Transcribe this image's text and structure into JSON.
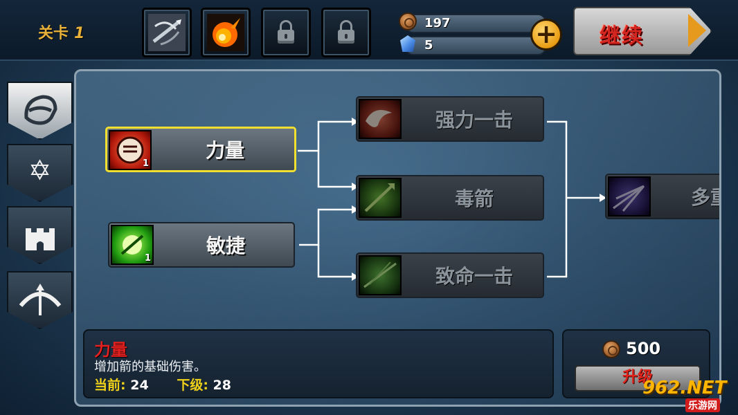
{
  "topbar": {
    "level_label": "关卡",
    "level_number": "1",
    "item_slots": [
      {
        "icon": "crossbow-icon",
        "locked": false
      },
      {
        "icon": "fireball-icon",
        "locked": false
      },
      {
        "icon": "lock-icon",
        "locked": true
      },
      {
        "icon": "lock-icon",
        "locked": true
      }
    ],
    "coins": "197",
    "gems": "5",
    "add_label": "+",
    "continue_label": "继续"
  },
  "side_tabs": [
    {
      "icon": "archer-helmet-icon",
      "active": true
    },
    {
      "icon": "star-icon",
      "active": false
    },
    {
      "icon": "castle-icon",
      "active": false
    },
    {
      "icon": "bow-icon",
      "active": false
    }
  ],
  "skill_tree": {
    "tier1": [
      {
        "label": "力量",
        "rank": "1",
        "icon": "fist-icon",
        "selected": true,
        "unlocked": true
      },
      {
        "label": "敏捷",
        "rank": "1",
        "icon": "agility-orb-icon",
        "selected": false,
        "unlocked": true
      }
    ],
    "tier2": [
      {
        "label": "强力一击",
        "icon": "power-strike-icon",
        "unlocked": false
      },
      {
        "label": "毒箭",
        "icon": "poison-arrow-icon",
        "unlocked": false
      },
      {
        "label": "致命一击",
        "icon": "critical-strike-icon",
        "unlocked": false
      }
    ],
    "tier3": [
      {
        "label": "多重",
        "icon": "multi-arrow-icon",
        "unlocked": false
      }
    ]
  },
  "info": {
    "skill_name": "力量",
    "description": "增加箭的基础伤害。",
    "current_label": "当前:",
    "current_value": "24",
    "next_label": "下级:",
    "next_value": "28"
  },
  "upgrade": {
    "cost": "500",
    "button_label": "升级"
  },
  "watermark": {
    "top": "962.NET",
    "bottom": "乐游网"
  },
  "colors": {
    "selected_border": "#f1e02d",
    "skill_name": "#e32020",
    "stat_label": "#f0d21a",
    "continue_text": "#d4251f"
  }
}
